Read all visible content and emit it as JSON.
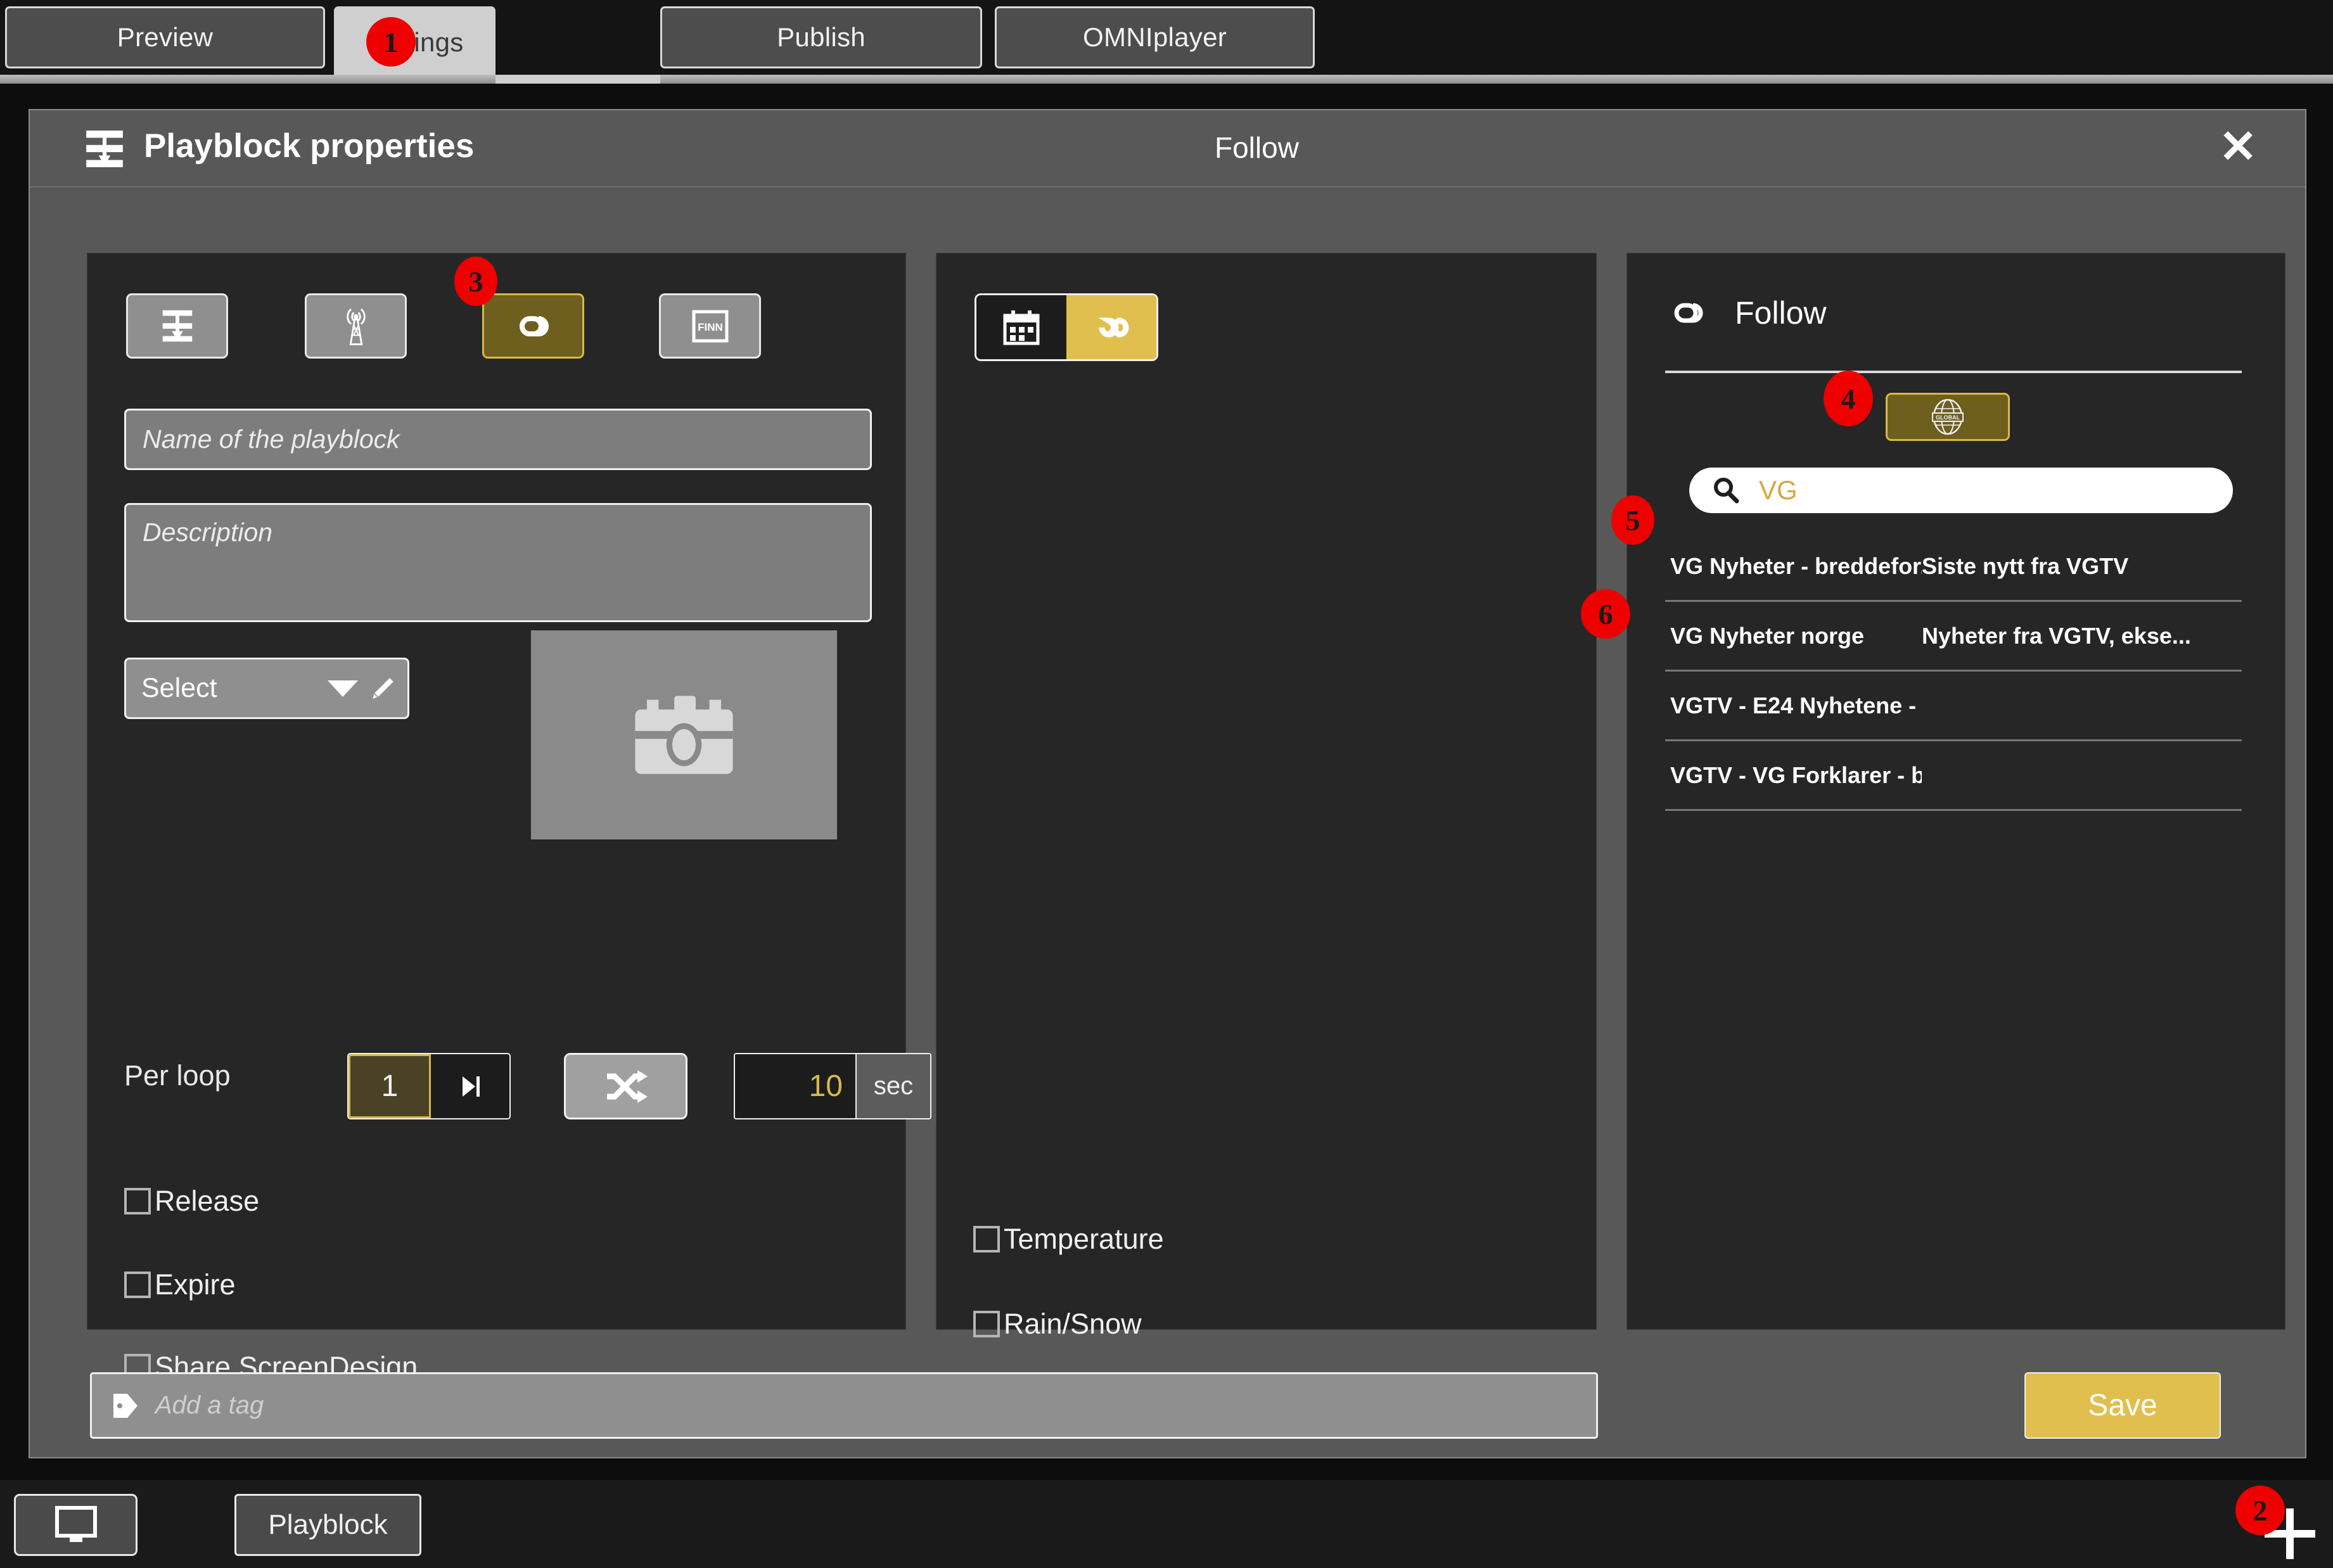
{
  "tabs": [
    {
      "label": "Preview",
      "active": false
    },
    {
      "label": "Settings",
      "active": true
    },
    {
      "label": "Publish",
      "active": false
    },
    {
      "label": "OMNIplayer",
      "active": false
    }
  ],
  "dialog": {
    "title": "Playblock properties",
    "subtitle": "Follow",
    "close_label": "✕"
  },
  "left_panel": {
    "mode_buttons": [
      {
        "name": "playblock-icon",
        "selected": false
      },
      {
        "name": "broadcast-tower-icon",
        "selected": false
      },
      {
        "name": "link-icon",
        "selected": true
      },
      {
        "name": "finn-icon",
        "selected": false,
        "text": "FINN"
      }
    ],
    "name_placeholder": "Name of the playblock",
    "description_placeholder": "Description",
    "select_label": "Select",
    "per_loop_label": "Per loop",
    "per_loop_value": "1",
    "duration_value": "10",
    "duration_unit": "sec",
    "checkboxes": [
      {
        "label": "Release",
        "checked": false
      },
      {
        "label": "Expire",
        "checked": false
      },
      {
        "label": "Share ScreenDesign",
        "checked": false
      }
    ]
  },
  "mid_panel": {
    "schedule_toggle": [
      {
        "icon": "calendar-icon",
        "selected": false
      },
      {
        "icon": "infinity-icon",
        "selected": true
      }
    ],
    "checkboxes": [
      {
        "label": "Temperature",
        "checked": false
      },
      {
        "label": "Rain/Snow",
        "checked": false
      }
    ]
  },
  "right_panel": {
    "heading": "Follow",
    "global_button_label": "GLOBAL",
    "search_value": "VG",
    "results": [
      {
        "title": "VG Nyheter - breddefor...",
        "subtitle": "Siste nytt fra VGTV"
      },
      {
        "title": "VG Nyheter norge",
        "subtitle": "Nyheter fra VGTV, ekse..."
      },
      {
        "title": "VGTV - E24 Nyhetene - ...",
        "subtitle": ""
      },
      {
        "title": "VGTV - VG Forklarer - br...",
        "subtitle": ""
      }
    ]
  },
  "footer": {
    "tag_placeholder": "Add a tag",
    "save_label": "Save"
  },
  "taskbar": {
    "monitor_icon": "monitor-icon",
    "playblock_label": "Playblock",
    "plus_icon": "plus-icon"
  },
  "markers": {
    "m1": "1",
    "m2": "2",
    "m3": "3",
    "m4": "4",
    "m5": "5",
    "m6": "6"
  },
  "colors": {
    "accent_gold": "#e0bf4e",
    "selected_olive": "#6e5f1f",
    "dialog_bg": "#585858",
    "panel_bg": "#262626",
    "marker_red": "#ee0000"
  }
}
